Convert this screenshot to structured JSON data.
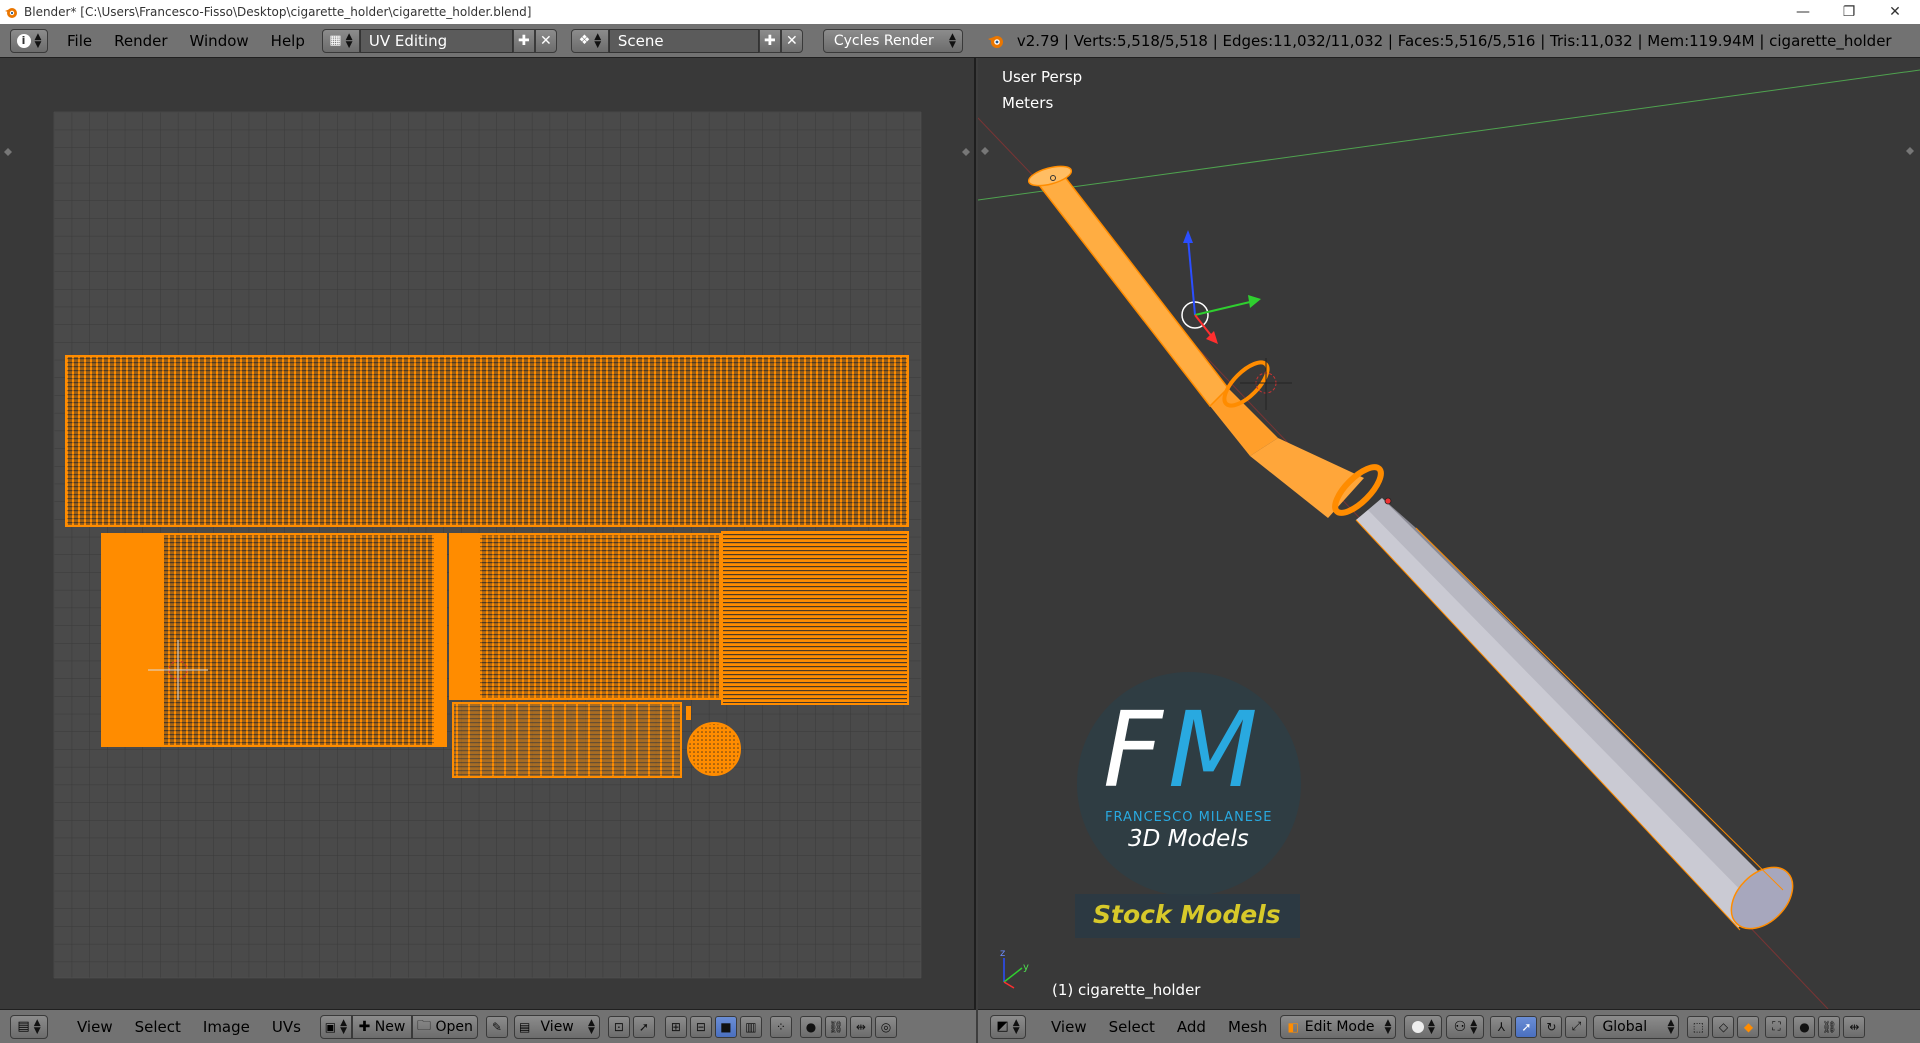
{
  "window": {
    "title": "Blender* [C:\\Users\\Francesco-Fisso\\Desktop\\cigarette_holder\\cigarette_holder.blend]",
    "minimize": "—",
    "restore": "❐",
    "close": "✕"
  },
  "top_menu": {
    "info_icon": "info-icon",
    "items": [
      "File",
      "Render",
      "Window",
      "Help"
    ],
    "screen_layout": "UV Editing",
    "scene": "Scene",
    "render_engine": "Cycles Render",
    "status": "v2.79 | Verts:5,518/5,518 | Edges:11,032/11,032 | Faces:5,516/5,516 | Tris:11,032 | Mem:119.94M | cigarette_holder"
  },
  "uv_editor": {
    "menu": [
      "View",
      "Select",
      "Image",
      "UVs"
    ],
    "new_label": "New",
    "open_label": "Open",
    "view_label": "View"
  },
  "viewport": {
    "view_name": "User Persp",
    "units": "Meters",
    "object_label": "(1) cigarette_holder",
    "menu": [
      "View",
      "Select",
      "Add",
      "Mesh"
    ],
    "mode": "Edit Mode",
    "orientation": "Global",
    "watermark": {
      "monogram_f": "F",
      "monogram_m": "M",
      "author": "FRANCESCO MILANESE",
      "subtitle": "3D Models",
      "banner": "Stock Models"
    }
  },
  "colors": {
    "uv_orange": "#ff8c00",
    "selection_blue": "#5c83d6",
    "header_gray": "#727272",
    "panel_bg": "#393939"
  }
}
